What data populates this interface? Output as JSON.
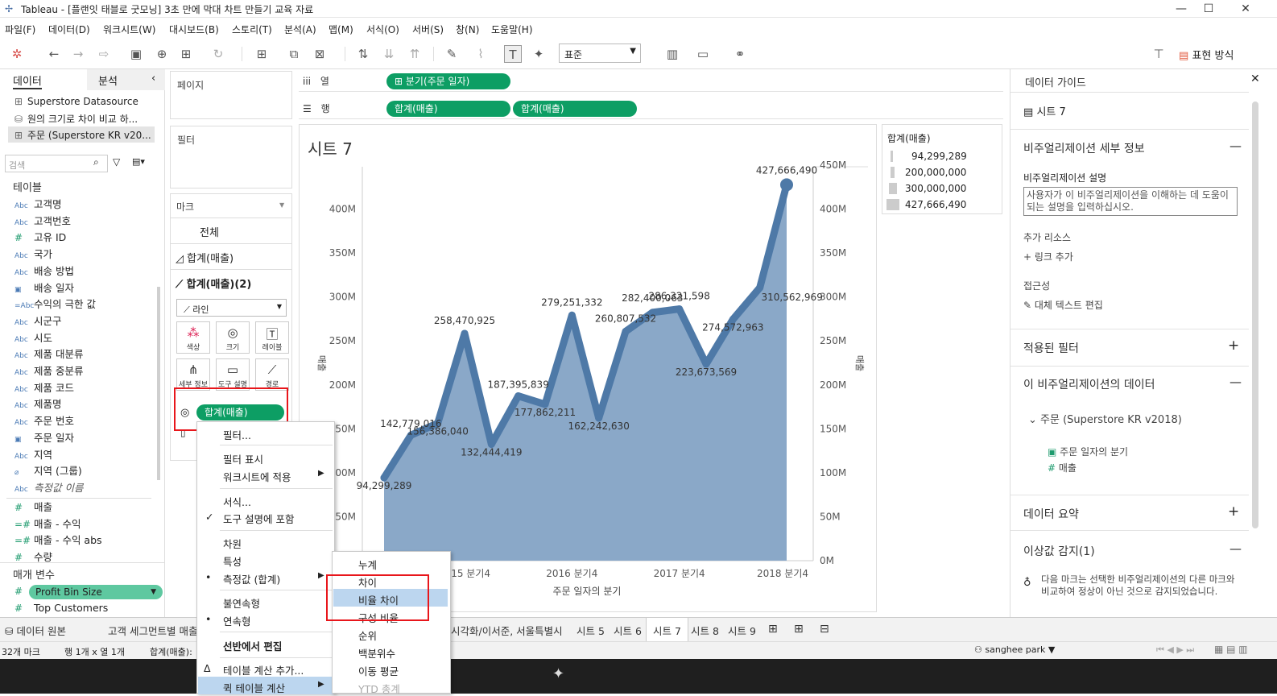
{
  "window": {
    "title": "Tableau - [플랜잇 태블로 굿모닝] 3초 만에 막대 차트 만들기 교육 자료"
  },
  "menu": [
    "파일(F)",
    "데이터(D)",
    "워크시트(W)",
    "대시보드(B)",
    "스토리(T)",
    "분석(A)",
    "맵(M)",
    "서식(O)",
    "서버(S)",
    "창(N)",
    "도움말(H)"
  ],
  "toolbar": {
    "fit_select": "표준",
    "show_me": "표현 방식"
  },
  "left": {
    "tab_data": "데이터",
    "tab_analysis": "분석",
    "datasources": [
      "Superstore Datasource",
      "원의 크기로 차이 비교 하...",
      "주문 (Superstore KR v20..."
    ],
    "search_placeholder": "검색",
    "tables_header": "테이블",
    "dimensions": [
      {
        "icon": "Abc",
        "name": "고객명"
      },
      {
        "icon": "Abc",
        "name": "고객번호"
      },
      {
        "icon": "#",
        "name": "고유 ID"
      },
      {
        "icon": "Abc",
        "name": "국가"
      },
      {
        "icon": "Abc",
        "name": "배송 방법"
      },
      {
        "icon": "cal",
        "name": "배송 일자"
      },
      {
        "icon": "=Abc",
        "name": "수익의 극한 값"
      },
      {
        "icon": "Abc",
        "name": "시군구"
      },
      {
        "icon": "Abc",
        "name": "시도"
      },
      {
        "icon": "Abc",
        "name": "제품 대분류"
      },
      {
        "icon": "Abc",
        "name": "제품 중분류"
      },
      {
        "icon": "Abc",
        "name": "제품 코드"
      },
      {
        "icon": "Abc",
        "name": "제품명"
      },
      {
        "icon": "Abc",
        "name": "주문 번호"
      },
      {
        "icon": "cal",
        "name": "주문 일자"
      },
      {
        "icon": "Abc",
        "name": "지역"
      },
      {
        "icon": "clip",
        "name": "지역 (그룹)"
      },
      {
        "icon": "Abc",
        "name": "측정값 이름"
      }
    ],
    "measures": [
      {
        "icon": "#",
        "name": "매출"
      },
      {
        "icon": "=#",
        "name": "매출 - 수익"
      },
      {
        "icon": "=#",
        "name": "매출 - 수익 abs"
      },
      {
        "icon": "#",
        "name": "수량"
      }
    ],
    "params_header": "매개 변수",
    "params": [
      "Profit Bin Size",
      "Top Customers"
    ]
  },
  "shelves": {
    "pages": "페이지",
    "filters": "필터",
    "columns_label": "열",
    "rows_label": "행",
    "column_pill": "분기(주문 일자)",
    "row_pills": [
      "합계(매출)",
      "합계(매출)"
    ]
  },
  "marks": {
    "header": "마크",
    "all": "전체",
    "m1": "합계(매출)",
    "m2": "합계(매출)(2)",
    "type": "라인",
    "buttons": [
      "색상",
      "크기",
      "레이블",
      "세부 정보",
      "도구 설명",
      "경로"
    ],
    "pill": "합계(매출)"
  },
  "sheet": {
    "title": "시트 7"
  },
  "legend": {
    "title": "합계(매출)",
    "items": [
      "94,299,289",
      "200,000,000",
      "300,000,000",
      "427,666,490"
    ]
  },
  "chart_data": {
    "type": "line",
    "title": "시트 7",
    "xlabel": "주문 일자의 분기",
    "ylabel": "매출",
    "x_ticks": [
      "2015 분기4",
      "2016 분기4",
      "2017 분기4",
      "2018 분기4"
    ],
    "x": [
      "2015 Q1",
      "2015 Q2",
      "2015 Q3",
      "2015 Q4",
      "2016 Q1",
      "2016 Q2",
      "2016 Q3",
      "2016 Q4",
      "2017 Q1",
      "2017 Q2",
      "2017 Q3",
      "2017 Q4",
      "2018 Q1",
      "2018 Q2",
      "2018 Q3",
      "2018 Q4"
    ],
    "series": [
      {
        "name": "합계(매출)",
        "values": [
          94299289,
          142779016,
          156386040,
          258470925,
          132444419,
          187395839,
          177862211,
          279251332,
          162242630,
          260807532,
          282400063,
          286321598,
          223673569,
          274572963,
          310562969,
          427666490
        ]
      }
    ],
    "data_labels": [
      "94,299,289",
      "142,779,016",
      "156,386,040",
      "258,470,925",
      "132,444,419",
      "187,395,839",
      "177,862,211",
      "279,251,332",
      "162,242,630",
      "260,807,532",
      "282,400,063",
      "286,321,598",
      "223,673,569",
      "274,572,963",
      "310,562,969",
      "427,666,490"
    ],
    "left_axis": {
      "ticks": [
        "400M",
        "350M",
        "300M",
        "250M",
        "200M",
        "150M",
        "100M",
        "50M"
      ],
      "ylim": [
        0,
        450000000
      ]
    },
    "right_axis": {
      "ticks": [
        "450M",
        "400M",
        "350M",
        "300M",
        "250M",
        "200M",
        "150M",
        "100M",
        "50M",
        "0M"
      ],
      "ylim": [
        0,
        450000000
      ]
    },
    "area": true
  },
  "right": {
    "title": "데이터 가이드",
    "sheet": "시트 7",
    "viz_details": "비주얼리제이션 세부 정보",
    "viz_desc_label": "비주얼리제이션 설명",
    "viz_desc_placeholder": "사용자가 이 비주얼리제이션을 이해하는 데 도움이 되는 설명을 입력하십시오.",
    "more_resources": "추가 리소스",
    "add_link": "링크 추가",
    "accessibility": "접근성",
    "alt_text": "대체 텍스트 편집",
    "applied_filters": "적용된 필터",
    "viz_data": "이 비주얼리제이션의 데이터",
    "source": "주문 (Superstore KR v2018)",
    "fields": [
      "주문 일자의 분기",
      "매출"
    ],
    "data_summary": "데이터 요약",
    "outliers": "이상값 감지(1)",
    "outlier_text": "다음 마크는 선택한 비주얼리제이션의 다른 마크와 비교하여 정상이 아닌 것으로 감지되었습니다."
  },
  "tabs": [
    "데이터 원본",
    "고객 세그먼트별 매출",
    "시각화/이서준, 서울특별시",
    "시트 5",
    "시트 6",
    "시트 7",
    "시트 8",
    "시트 9"
  ],
  "status": {
    "marks": "32개 마크",
    "rows": "행 1개 x 열 1개",
    "sum": "합계(매출):",
    "user": "sanghee park"
  },
  "context_menu": {
    "items": [
      "필터...",
      "필터 표시",
      "워크시트에 적용",
      "서식...",
      "도구 설명에 포함",
      "차원",
      "특성",
      "측정값 (합계)",
      "불연속형",
      "연속형",
      "선반에서 편집",
      "테이블 계산 추가...",
      "퀵 테이블 계산"
    ]
  },
  "submenu": {
    "items": [
      "누계",
      "차이",
      "비율 차이",
      "구성 비율",
      "순위",
      "백분위수",
      "이동 평균",
      "YTD 총계"
    ]
  }
}
